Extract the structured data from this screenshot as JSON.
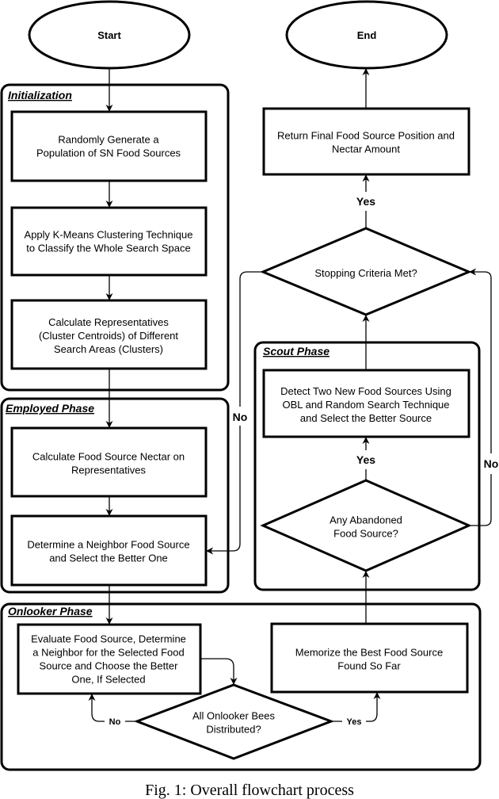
{
  "figure": {
    "caption": "Fig. 1: Overall flowchart process",
    "terminals": {
      "start": "Start",
      "end": "End"
    },
    "phases": {
      "initialization": "Initialization",
      "employed": "Employed Phase",
      "onlooker": "Onlooker Phase",
      "scout": "Scout Phase"
    },
    "nodes": {
      "init_generate": [
        "Randomly Generate a",
        "Population of SN Food Sources"
      ],
      "init_kmeans": [
        "Apply K-Means Clustering Technique",
        "to Classify the Whole Search Space"
      ],
      "init_representatives": [
        "Calculate Representatives",
        "(Cluster Centroids) of Different",
        "Search Areas (Clusters)"
      ],
      "employed_nectar": [
        "Calculate Food Source Nectar on",
        "Representatives"
      ],
      "employed_neighbor": [
        "Determine a Neighbor Food Source",
        "and Select the Better One"
      ],
      "onlooker_evaluate": [
        "Evaluate Food Source, Determine",
        "a Neighbor for the Selected Food",
        "Source and Choose the Better",
        "One, If Selected"
      ],
      "onlooker_decision": [
        "All Onlooker Bees",
        "Distributed?"
      ],
      "memorize_best": [
        "Memorize the Best Food Source",
        "Found So Far"
      ],
      "scout_decision": [
        "Any Abandoned",
        "Food Source?"
      ],
      "scout_detect": [
        "Detect Two New Food Sources Using",
        "OBL and Random Search Technique",
        "and Select the Better Source"
      ],
      "stopping_decision": [
        "Stopping Criteria Met?"
      ],
      "return_final": [
        "Return Final Food Source Position and",
        "Nectar Amount"
      ]
    },
    "edge_labels": {
      "stop_yes": "Yes",
      "stop_no": "No",
      "scout_yes": "Yes",
      "scout_no": "No",
      "onlooker_no": "No",
      "onlooker_yes": "Yes"
    }
  }
}
